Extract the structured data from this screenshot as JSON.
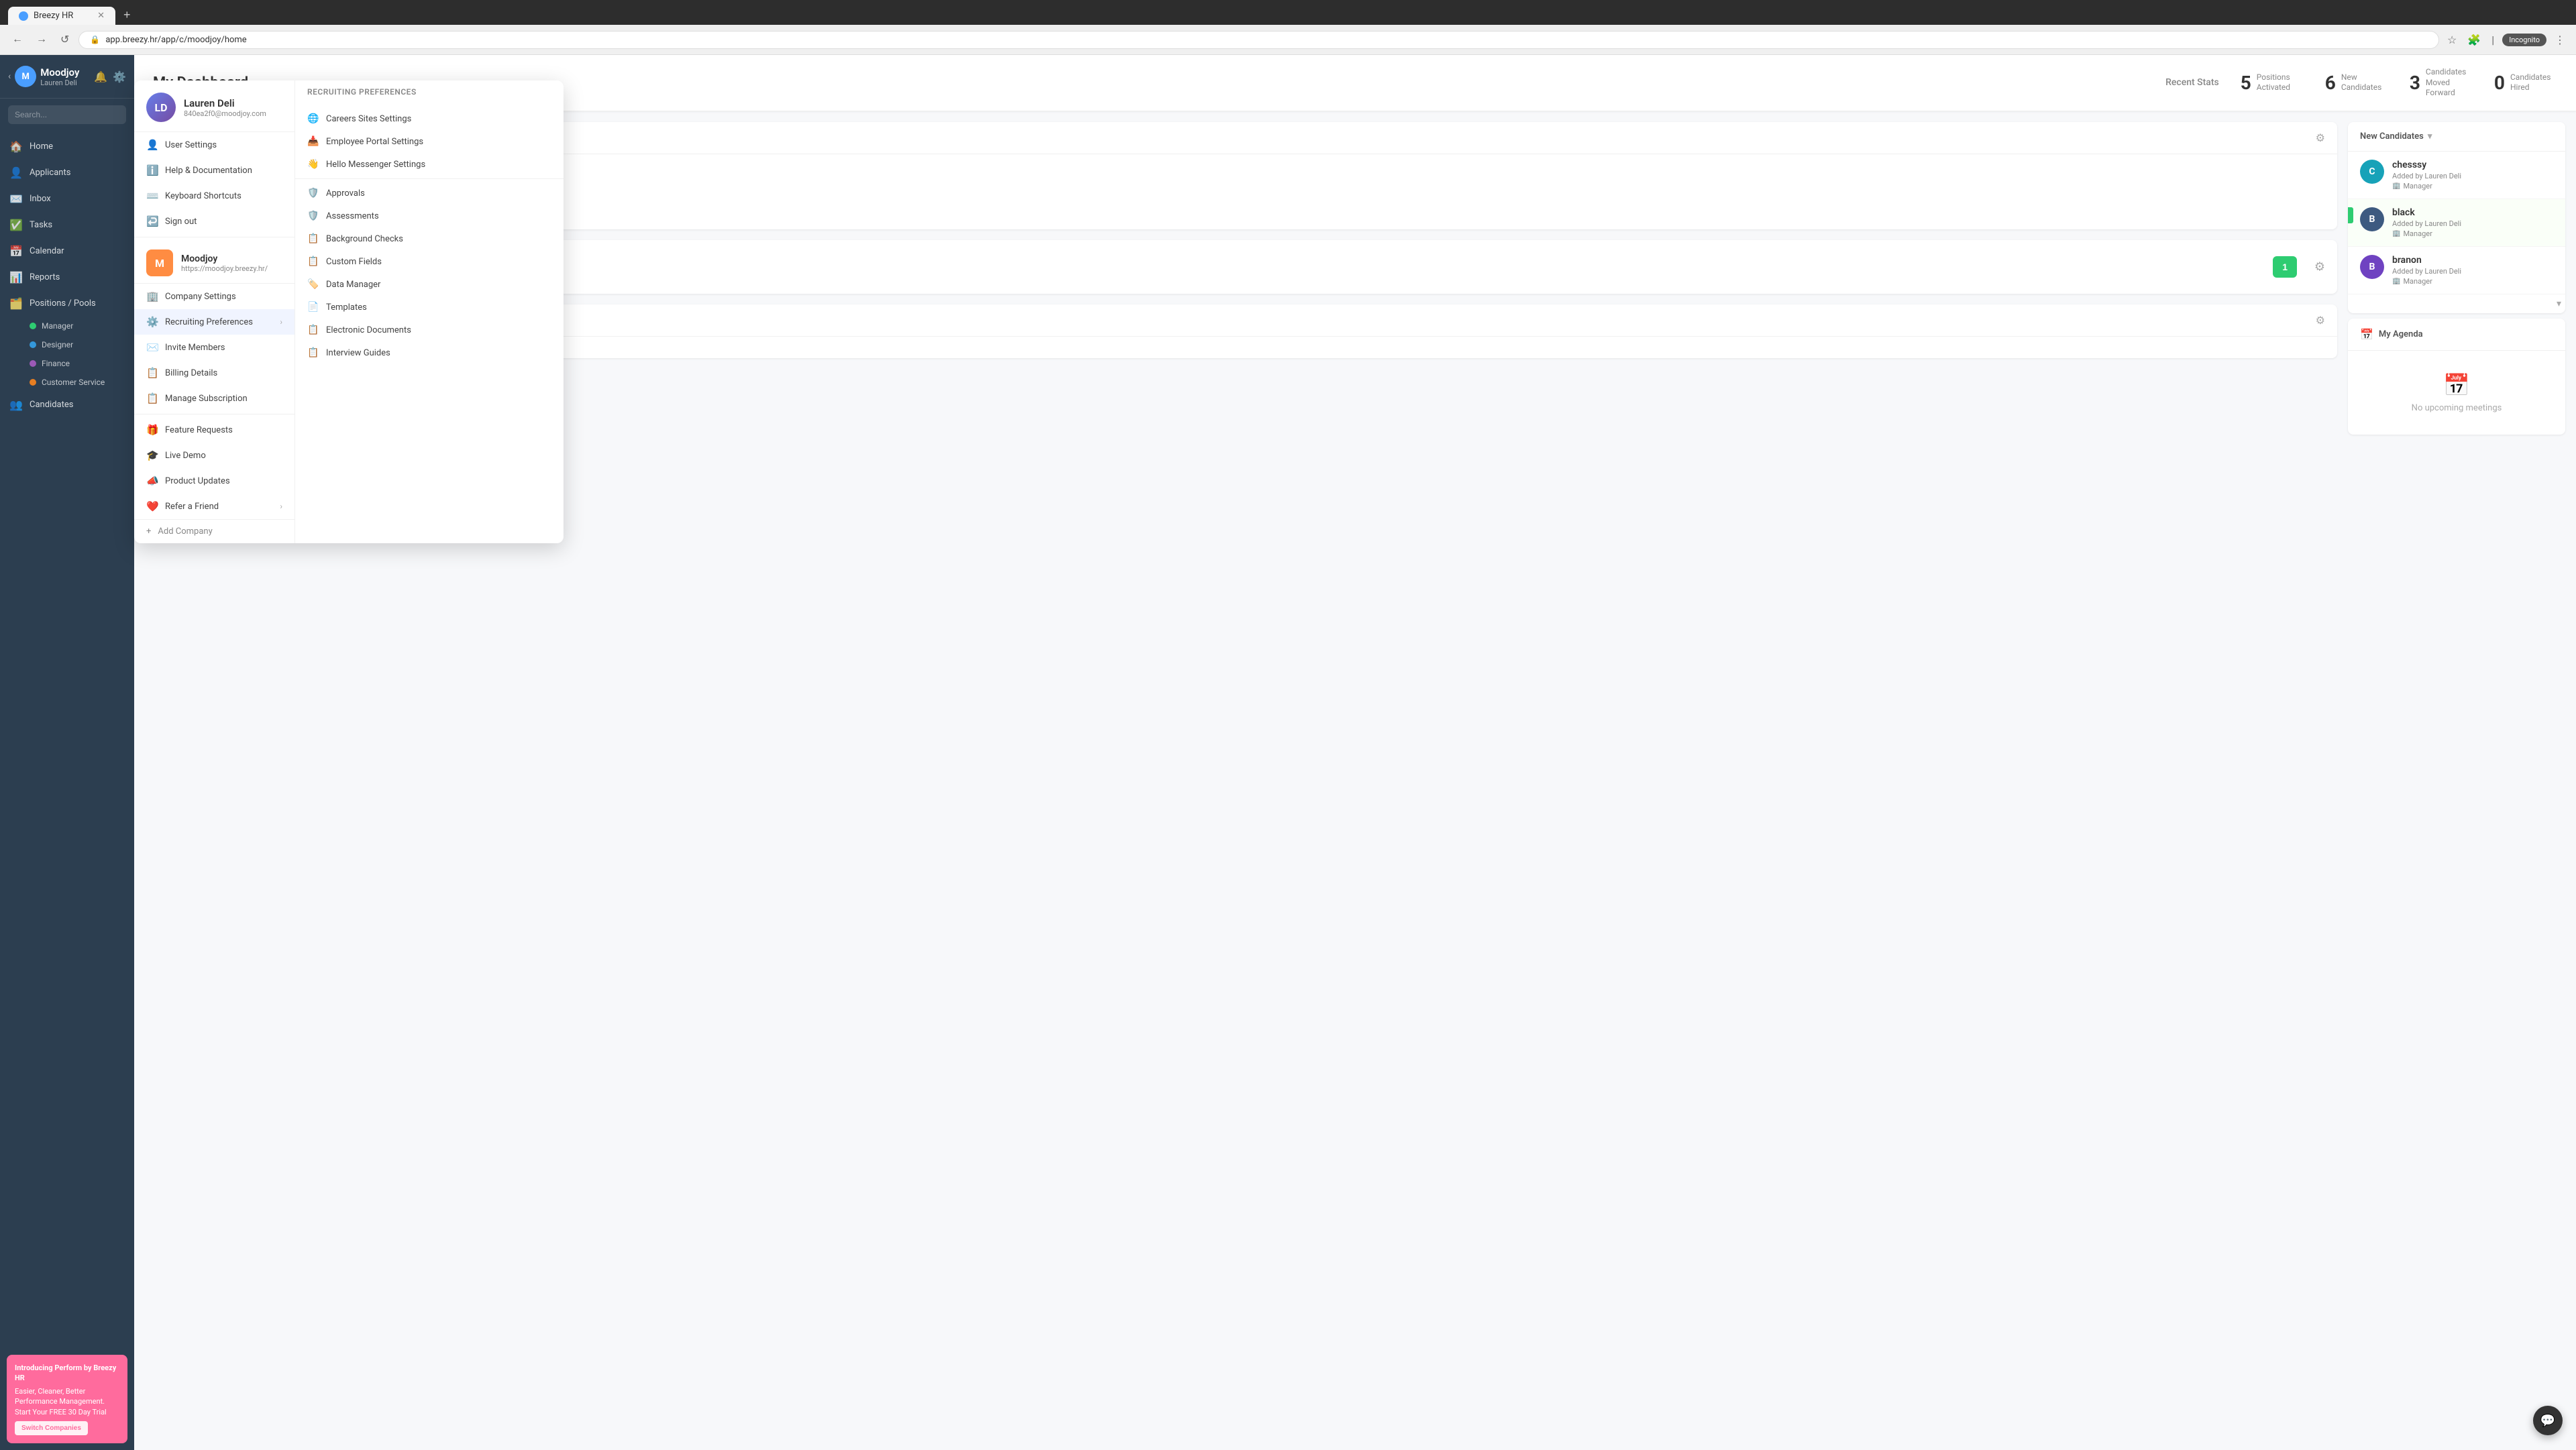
{
  "browser": {
    "tab_title": "Breezy HR",
    "tab_new_label": "+",
    "url": "app.breezy.hr/app/c/moodjoy/home",
    "incognito_label": "Incognito"
  },
  "sidebar": {
    "brand": "Moodjoy",
    "user": "Lauren Deli",
    "initial": "M",
    "search_placeholder": "Search...",
    "nav_items": [
      {
        "label": "Home",
        "icon": "🏠"
      },
      {
        "label": "Applicants",
        "icon": "👤"
      },
      {
        "label": "Inbox",
        "icon": "✉️"
      },
      {
        "label": "Tasks",
        "icon": "✅"
      },
      {
        "label": "Calendar",
        "icon": "📅"
      },
      {
        "label": "Reports",
        "icon": "📊"
      },
      {
        "label": "Positions / Pools",
        "icon": "🗂️"
      }
    ],
    "submenu_items": [
      {
        "label": "Manager",
        "dot_color": "green"
      },
      {
        "label": "Designer",
        "dot_color": "blue"
      },
      {
        "label": "Finance",
        "dot_color": "purple"
      },
      {
        "label": "Customer Service",
        "dot_color": "orange"
      }
    ],
    "candidates_label": "Candidates",
    "promo_title": "Introducing Perform by Breezy HR",
    "promo_body": "Easier, Cleaner, Better Performance Management. Start Your FREE 30 Day Trial",
    "promo_btn": "Switch Companies"
  },
  "header": {
    "title": "My Dashboard",
    "recent_stats_label": "Recent Stats",
    "stats": [
      {
        "number": "5",
        "label": "Positions Activated"
      },
      {
        "number": "6",
        "label": "New Candidates"
      },
      {
        "number": "3",
        "label": "Candidates Moved Forward"
      },
      {
        "number": "0",
        "label": "Candidates Hired"
      }
    ]
  },
  "candidates": {
    "header": "New Candidates",
    "items": [
      {
        "name": "chesssy",
        "added_by": "Added by Lauren Deli",
        "role": "Manager",
        "avatar_letter": "C",
        "avatar_class": "avatar-cyan"
      },
      {
        "name": "black",
        "added_by": "Added by Lauren Deli",
        "role": "Manager",
        "avatar_letter": "B",
        "avatar_class": "avatar-blue",
        "highlighted": true
      },
      {
        "name": "branon",
        "added_by": "Added by Lauren Deli",
        "role": "Manager",
        "avatar_letter": "B",
        "avatar_class": "avatar-purple"
      }
    ]
  },
  "agenda": {
    "title": "My Agenda",
    "no_meetings_text": "No upcoming meetings"
  },
  "dropdown": {
    "user_name": "Lauren Deli",
    "user_email": "840ea2f0@moodjoy.com",
    "user_initial": "LD",
    "menu_items": [
      {
        "label": "User Settings",
        "icon": "👤"
      },
      {
        "label": "Help & Documentation",
        "icon": "ℹ️"
      },
      {
        "label": "Keyboard Shortcuts",
        "icon": "⌨️"
      },
      {
        "label": "Sign out",
        "icon": "↩️"
      }
    ],
    "company_name": "Moodjoy",
    "company_url": "https://moodjoy.breezy.hr/",
    "company_initial": "M",
    "company_menu_items": [
      {
        "label": "Company Settings",
        "icon": "🏢"
      },
      {
        "label": "Recruiting Preferences",
        "icon": "⚙️",
        "has_arrow": true
      },
      {
        "label": "Invite Members",
        "icon": "✉️"
      },
      {
        "label": "Billing Details",
        "icon": "📋"
      },
      {
        "label": "Manage Subscription",
        "icon": "📋"
      }
    ],
    "bottom_items": [
      {
        "label": "Feature Requests",
        "icon": "🎁"
      },
      {
        "label": "Live Demo",
        "icon": "🎓"
      },
      {
        "label": "Product Updates",
        "icon": "📣"
      },
      {
        "label": "Refer a Friend",
        "icon": "❤️",
        "has_arrow": true
      }
    ],
    "add_company": "Add Company",
    "recruiting_title": "Recruiting Preferences",
    "recruiting_items": [
      {
        "label": "Careers Sites Settings",
        "icon": "🌐"
      },
      {
        "label": "Employee Portal Settings",
        "icon": "📥"
      },
      {
        "label": "Hello Messenger Settings",
        "icon": "👋"
      },
      {
        "label": "Approvals",
        "icon": "🛡️"
      },
      {
        "label": "Assessments",
        "icon": "🛡️"
      },
      {
        "label": "Background Checks",
        "icon": "📋"
      },
      {
        "label": "Custom Fields",
        "icon": "📋"
      },
      {
        "label": "Data Manager",
        "icon": "🏷️"
      },
      {
        "label": "Templates",
        "icon": "📄"
      },
      {
        "label": "Electronic Documents",
        "icon": "📋"
      },
      {
        "label": "Interview Guides",
        "icon": "📋"
      }
    ]
  }
}
